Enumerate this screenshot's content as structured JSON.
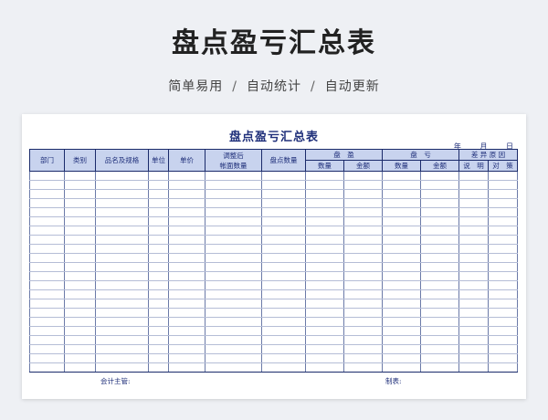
{
  "hero": {
    "title": "盘点盈亏汇总表",
    "features": [
      "简单易用",
      "自动统计",
      "自动更新"
    ],
    "separator": "/"
  },
  "sheet": {
    "title": "盘点盈亏汇总表",
    "date_labels": [
      "年",
      "月",
      "日"
    ],
    "headers": {
      "dept": "部门",
      "category": "类别",
      "name_spec": "品名及规格",
      "unit": "单位",
      "price": "单价",
      "adjusted_line1": "调整后",
      "adjusted_line2": "帐面数量",
      "count_qty": "盘点数量",
      "surplus": "盘　盈",
      "deficit": "盘　亏",
      "reason": "差 异 原 因",
      "qty": "数量",
      "amount": "金额",
      "explain": "说　明",
      "measure": "对　策"
    },
    "footer": {
      "supervisor": "会计主管:",
      "preparer": "制表:"
    }
  }
}
